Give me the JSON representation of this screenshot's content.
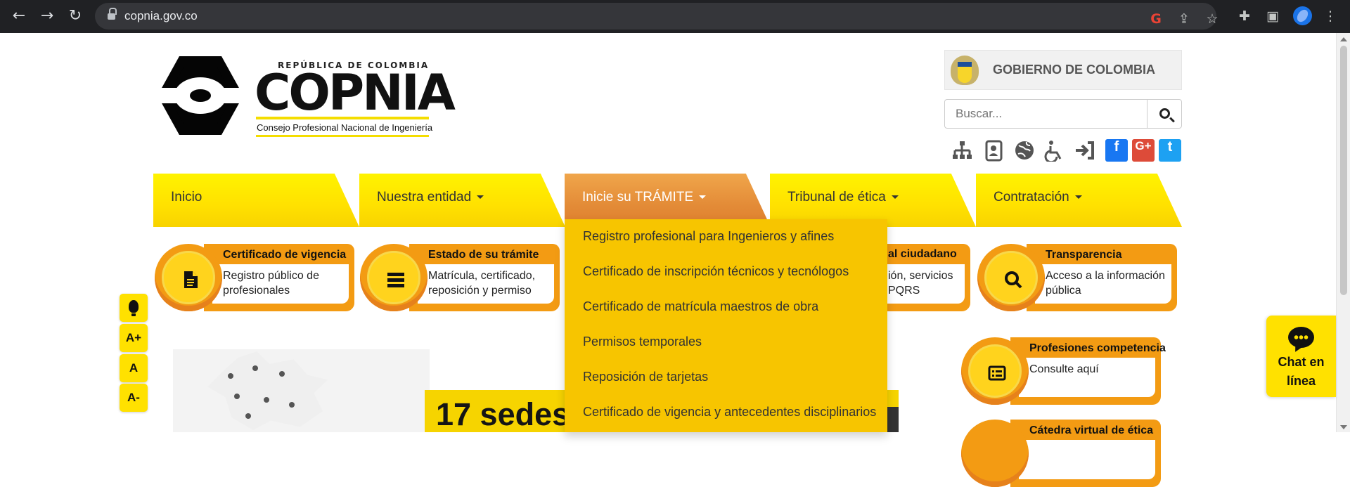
{
  "browser": {
    "url": "copnia.gov.co",
    "icons": [
      "back-icon",
      "forward-icon",
      "reload-icon",
      "lock-icon",
      "google-icon",
      "share-icon",
      "bookmark-star-icon",
      "extensions-icon",
      "sidebar-icon",
      "profile-avatar",
      "more-vert-icon"
    ]
  },
  "header": {
    "logo": {
      "subtitle": "REPÚBLICA DE COLOMBIA",
      "name": "COPNIA",
      "tagline": "Consejo Profesional Nacional de Ingeniería"
    },
    "government": {
      "label": "GOBIERNO DE COLOMBIA"
    },
    "search": {
      "placeholder": "Buscar..."
    },
    "utility_icons": [
      "sitemap-icon",
      "contact-card-icon",
      "globe-icon",
      "accessibility-icon",
      "login-icon",
      "facebook-icon",
      "google-plus-icon",
      "twitter-icon"
    ],
    "social_labels": {
      "facebook": "f",
      "google_plus": "G+",
      "twitter": "t"
    }
  },
  "navigation": {
    "tabs": [
      {
        "label": "Inicio",
        "has_dropdown": false
      },
      {
        "label": "Nuestra entidad",
        "has_dropdown": true
      },
      {
        "label": "Inicie su TRÁMITE",
        "has_dropdown": true,
        "active": true
      },
      {
        "label": "Tribunal de ética",
        "has_dropdown": true
      },
      {
        "label": "Contratación",
        "has_dropdown": true
      }
    ],
    "dropdown": [
      "Registro profesional para Ingenieros y afines",
      "Certificado de inscripción técnicos y tecnólogos",
      "Certificado de matrícula maestros de obra",
      "Permisos temporales",
      "Reposición de tarjetas",
      "Certificado de vigencia y antecedentes disciplinarios"
    ]
  },
  "quick_links": [
    {
      "title": "Certificado de vigencia",
      "description": "Registro público de profesionales",
      "icon": "document-icon"
    },
    {
      "title": "Estado de su trámite",
      "description": "Matrícula, certificado, reposición y permiso",
      "icon": "list-icon"
    },
    {
      "title": "al ciudadano",
      "description": "ión, servicios PQRS"
    },
    {
      "title": "Transparencia",
      "description": "Acceso a la información pública",
      "icon": "search-icon"
    },
    {
      "title": "Profesiones competencia",
      "description": "Consulte aquí",
      "icon": "list-card-icon"
    },
    {
      "title": "Cátedra virtual de ética",
      "description": ""
    }
  ],
  "accessibility": {
    "buttons": [
      {
        "label": "",
        "icon": "lightbulb-icon"
      },
      {
        "label": "A+"
      },
      {
        "label": "A"
      },
      {
        "label": "A-"
      }
    ]
  },
  "banner": {
    "headline": "17 sedes"
  },
  "chat": {
    "label": "Chat en línea"
  },
  "colors": {
    "browser_bar": "#202124",
    "tab_yellow": "#ffe100",
    "tab_active_orange": "#e38b37",
    "dropdown_yellow": "#f7c500",
    "card_orange": "#f39b13",
    "facebook_blue": "#1877f2",
    "google_red": "#dd4b39",
    "twitter_blue": "#1da1f2"
  }
}
